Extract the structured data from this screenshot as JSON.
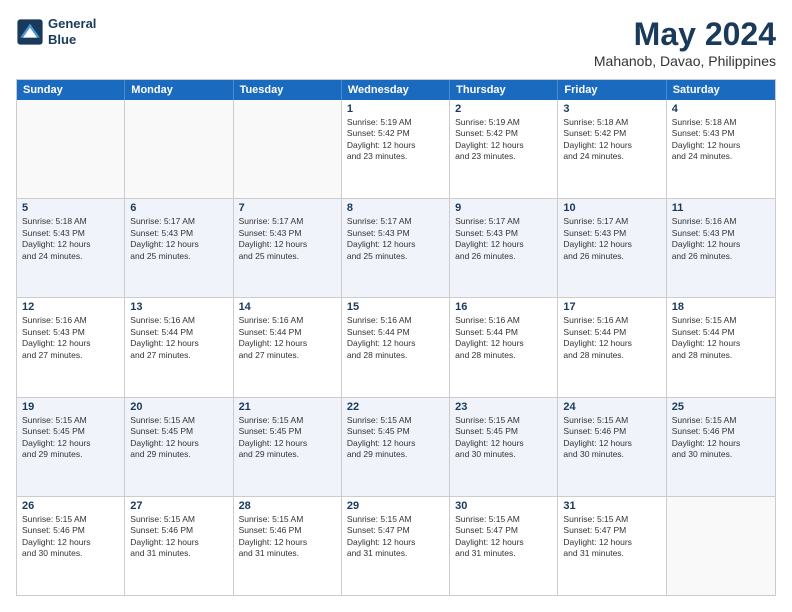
{
  "header": {
    "logo_line1": "General",
    "logo_line2": "Blue",
    "month": "May 2024",
    "location": "Mahanob, Davao, Philippines"
  },
  "day_headers": [
    "Sunday",
    "Monday",
    "Tuesday",
    "Wednesday",
    "Thursday",
    "Friday",
    "Saturday"
  ],
  "weeks": [
    [
      {
        "num": "",
        "info": ""
      },
      {
        "num": "",
        "info": ""
      },
      {
        "num": "",
        "info": ""
      },
      {
        "num": "1",
        "info": "Sunrise: 5:19 AM\nSunset: 5:42 PM\nDaylight: 12 hours\nand 23 minutes."
      },
      {
        "num": "2",
        "info": "Sunrise: 5:19 AM\nSunset: 5:42 PM\nDaylight: 12 hours\nand 23 minutes."
      },
      {
        "num": "3",
        "info": "Sunrise: 5:18 AM\nSunset: 5:42 PM\nDaylight: 12 hours\nand 24 minutes."
      },
      {
        "num": "4",
        "info": "Sunrise: 5:18 AM\nSunset: 5:43 PM\nDaylight: 12 hours\nand 24 minutes."
      }
    ],
    [
      {
        "num": "5",
        "info": "Sunrise: 5:18 AM\nSunset: 5:43 PM\nDaylight: 12 hours\nand 24 minutes."
      },
      {
        "num": "6",
        "info": "Sunrise: 5:17 AM\nSunset: 5:43 PM\nDaylight: 12 hours\nand 25 minutes."
      },
      {
        "num": "7",
        "info": "Sunrise: 5:17 AM\nSunset: 5:43 PM\nDaylight: 12 hours\nand 25 minutes."
      },
      {
        "num": "8",
        "info": "Sunrise: 5:17 AM\nSunset: 5:43 PM\nDaylight: 12 hours\nand 25 minutes."
      },
      {
        "num": "9",
        "info": "Sunrise: 5:17 AM\nSunset: 5:43 PM\nDaylight: 12 hours\nand 26 minutes."
      },
      {
        "num": "10",
        "info": "Sunrise: 5:17 AM\nSunset: 5:43 PM\nDaylight: 12 hours\nand 26 minutes."
      },
      {
        "num": "11",
        "info": "Sunrise: 5:16 AM\nSunset: 5:43 PM\nDaylight: 12 hours\nand 26 minutes."
      }
    ],
    [
      {
        "num": "12",
        "info": "Sunrise: 5:16 AM\nSunset: 5:43 PM\nDaylight: 12 hours\nand 27 minutes."
      },
      {
        "num": "13",
        "info": "Sunrise: 5:16 AM\nSunset: 5:44 PM\nDaylight: 12 hours\nand 27 minutes."
      },
      {
        "num": "14",
        "info": "Sunrise: 5:16 AM\nSunset: 5:44 PM\nDaylight: 12 hours\nand 27 minutes."
      },
      {
        "num": "15",
        "info": "Sunrise: 5:16 AM\nSunset: 5:44 PM\nDaylight: 12 hours\nand 28 minutes."
      },
      {
        "num": "16",
        "info": "Sunrise: 5:16 AM\nSunset: 5:44 PM\nDaylight: 12 hours\nand 28 minutes."
      },
      {
        "num": "17",
        "info": "Sunrise: 5:16 AM\nSunset: 5:44 PM\nDaylight: 12 hours\nand 28 minutes."
      },
      {
        "num": "18",
        "info": "Sunrise: 5:15 AM\nSunset: 5:44 PM\nDaylight: 12 hours\nand 28 minutes."
      }
    ],
    [
      {
        "num": "19",
        "info": "Sunrise: 5:15 AM\nSunset: 5:45 PM\nDaylight: 12 hours\nand 29 minutes."
      },
      {
        "num": "20",
        "info": "Sunrise: 5:15 AM\nSunset: 5:45 PM\nDaylight: 12 hours\nand 29 minutes."
      },
      {
        "num": "21",
        "info": "Sunrise: 5:15 AM\nSunset: 5:45 PM\nDaylight: 12 hours\nand 29 minutes."
      },
      {
        "num": "22",
        "info": "Sunrise: 5:15 AM\nSunset: 5:45 PM\nDaylight: 12 hours\nand 29 minutes."
      },
      {
        "num": "23",
        "info": "Sunrise: 5:15 AM\nSunset: 5:45 PM\nDaylight: 12 hours\nand 30 minutes."
      },
      {
        "num": "24",
        "info": "Sunrise: 5:15 AM\nSunset: 5:46 PM\nDaylight: 12 hours\nand 30 minutes."
      },
      {
        "num": "25",
        "info": "Sunrise: 5:15 AM\nSunset: 5:46 PM\nDaylight: 12 hours\nand 30 minutes."
      }
    ],
    [
      {
        "num": "26",
        "info": "Sunrise: 5:15 AM\nSunset: 5:46 PM\nDaylight: 12 hours\nand 30 minutes."
      },
      {
        "num": "27",
        "info": "Sunrise: 5:15 AM\nSunset: 5:46 PM\nDaylight: 12 hours\nand 31 minutes."
      },
      {
        "num": "28",
        "info": "Sunrise: 5:15 AM\nSunset: 5:46 PM\nDaylight: 12 hours\nand 31 minutes."
      },
      {
        "num": "29",
        "info": "Sunrise: 5:15 AM\nSunset: 5:47 PM\nDaylight: 12 hours\nand 31 minutes."
      },
      {
        "num": "30",
        "info": "Sunrise: 5:15 AM\nSunset: 5:47 PM\nDaylight: 12 hours\nand 31 minutes."
      },
      {
        "num": "31",
        "info": "Sunrise: 5:15 AM\nSunset: 5:47 PM\nDaylight: 12 hours\nand 31 minutes."
      },
      {
        "num": "",
        "info": ""
      }
    ]
  ]
}
